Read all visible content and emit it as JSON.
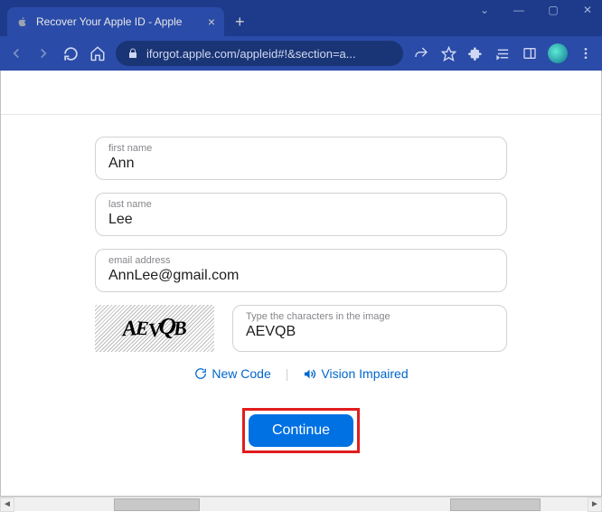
{
  "browser": {
    "tab_title": "Recover Your Apple ID - Apple",
    "url": "iforgot.apple.com/appleid#!&section=a..."
  },
  "form": {
    "first_name": {
      "label": "first name",
      "value": "Ann"
    },
    "last_name": {
      "label": "last name",
      "value": "Lee"
    },
    "email": {
      "label": "email address",
      "value": "AnnLee@gmail.com"
    },
    "captcha": {
      "image_text": "AEVQB",
      "input_label": "Type the characters in the image",
      "input_value": "AEVQB"
    },
    "links": {
      "new_code": "New Code",
      "vision_impaired": "Vision Impaired"
    },
    "continue_label": "Continue"
  }
}
